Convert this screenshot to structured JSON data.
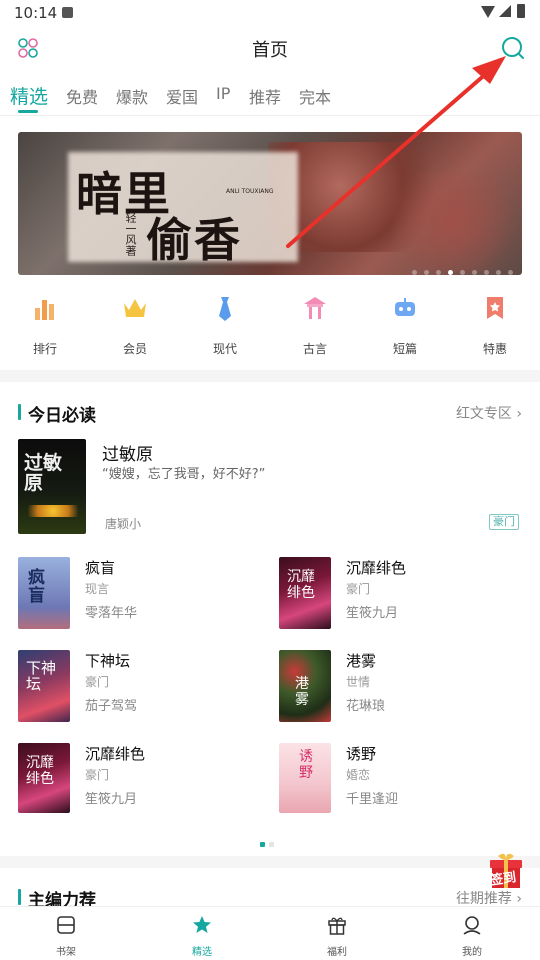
{
  "status_bar": {
    "time": "10:14"
  },
  "header": {
    "title": "首页"
  },
  "tabs": [
    {
      "label": "精选",
      "active": true
    },
    {
      "label": "免费"
    },
    {
      "label": "爆款"
    },
    {
      "label": "爱国"
    },
    {
      "label": "IP"
    },
    {
      "label": "推荐"
    },
    {
      "label": "完本"
    }
  ],
  "banner": {
    "title_line1": "暗里",
    "title_line2": "偷香",
    "author": "轻一风著",
    "subtitle": "ANLI TOUXIANG"
  },
  "categories": [
    {
      "label": "排行",
      "icon": "ranking-icon"
    },
    {
      "label": "会员",
      "icon": "crown-icon"
    },
    {
      "label": "现代",
      "icon": "tie-icon"
    },
    {
      "label": "古言",
      "icon": "pavilion-icon"
    },
    {
      "label": "短篇",
      "icon": "robot-icon"
    },
    {
      "label": "特惠",
      "icon": "discount-tag-icon"
    }
  ],
  "today_section": {
    "title": "今日必读",
    "more": "红文专区",
    "featured": {
      "title": "过敏原",
      "desc": "“嫂嫂，忘了我哥，好不好?”",
      "author": "唐颖小",
      "tag": "豪门"
    },
    "books": [
      {
        "title": "疯盲",
        "category": "现言",
        "author": "零落年华"
      },
      {
        "title": "沉靡绯色",
        "category": "豪门",
        "author": "笙筱九月"
      },
      {
        "title": "下神坛",
        "category": "豪门",
        "author": "茄子驾驾"
      },
      {
        "title": "港雾",
        "category": "世情",
        "author": "花琳琅"
      },
      {
        "title": "沉靡绯色",
        "category": "豪门",
        "author": "笙筱九月"
      },
      {
        "title": "诱野",
        "category": "婚恋",
        "author": "千里逢迎"
      }
    ]
  },
  "editor_section": {
    "title": "主编力荐",
    "more": "往期推荐"
  },
  "gift_badge": {
    "label": "签到"
  },
  "bottom_nav": [
    {
      "label": "书架",
      "icon": "bookshelf-icon"
    },
    {
      "label": "精选",
      "icon": "star-icon",
      "active": true
    },
    {
      "label": "福利",
      "icon": "gift-icon"
    },
    {
      "label": "我的",
      "icon": "profile-icon"
    }
  ],
  "colors": {
    "accent": "#15a7a0",
    "annotation_arrow": "#e8312a"
  }
}
